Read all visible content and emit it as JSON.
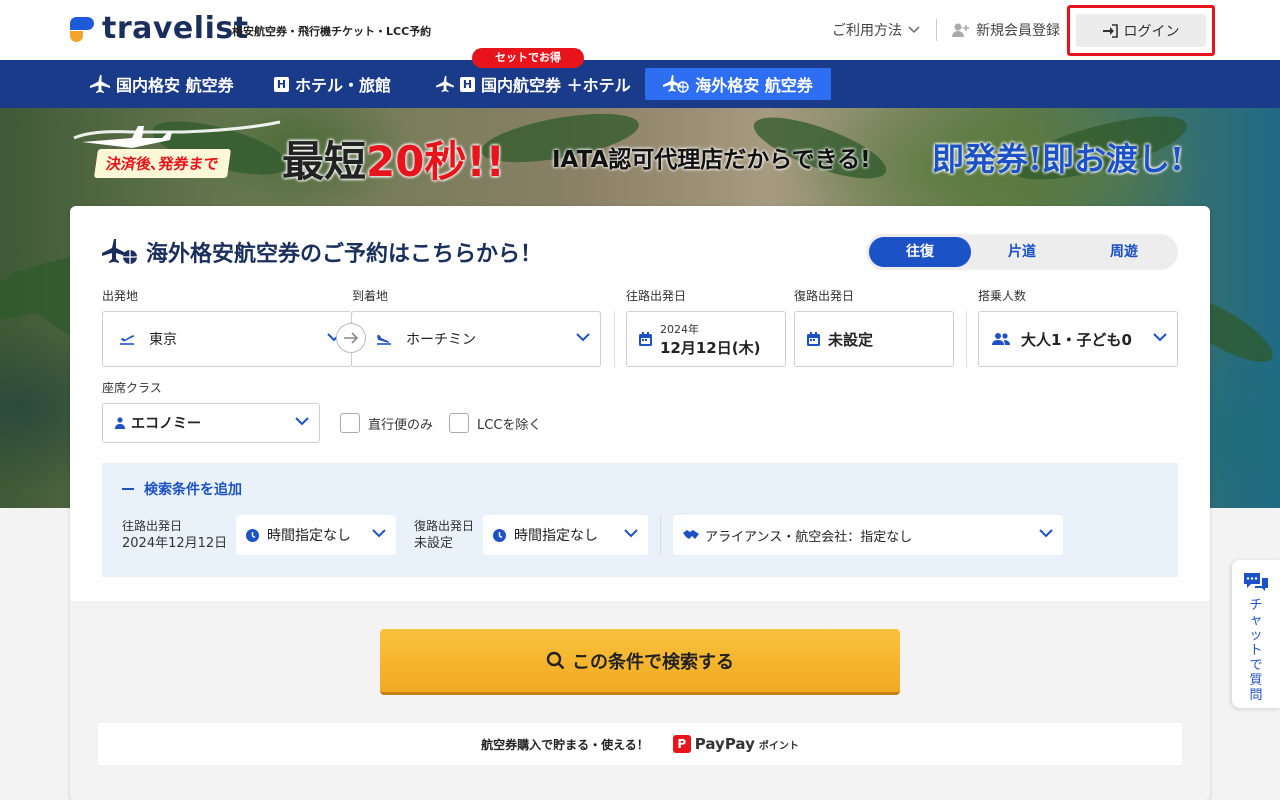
{
  "header": {
    "logo_text": "travelist",
    "tagline": "格安航空券・飛行機チケット・LCC予約",
    "help_label": "ご利用方法",
    "register_label": "新規会員登録",
    "login_label": "ログイン"
  },
  "nav": {
    "set_badge": "セットでお得",
    "items": [
      {
        "label": "国内格安 航空券",
        "icon": "airplane-icon"
      },
      {
        "label": "ホテル・旅館",
        "icon": "hotel-icon",
        "badge": "H"
      },
      {
        "label": "国内航空券 ＋ホテル",
        "icon": "airplane-hotel-icon",
        "badge": "H"
      },
      {
        "label": "海外格安 航空券",
        "icon": "airplane-globe-icon",
        "active": true
      }
    ]
  },
  "hero": {
    "tag": "決済後､発券まで",
    "big_prefix": "最短",
    "big_number": "20秒!!",
    "middle": "IATA認可代理店だからできる!",
    "blue": "即発券!即お渡し!"
  },
  "form": {
    "title": "海外格安航空券のご予約はこちらから！",
    "trip_types": [
      "往復",
      "片道",
      "周遊"
    ],
    "trip_active": "往復",
    "origin_label": "出発地",
    "origin_value": "東京",
    "destination_label": "到着地",
    "destination_value": "ホーチミン",
    "outbound_label": "往路出発日",
    "outbound_year": "2024年",
    "outbound_date": "12月12日(木)",
    "return_label": "復路出発日",
    "return_value": "未設定",
    "passengers_label": "搭乗人数",
    "passengers_value": "大人1・子ども0",
    "class_label": "座席クラス",
    "class_value": "エコノミー",
    "direct_only_label": "直行便のみ",
    "exclude_lcc_label": "LCCを除く"
  },
  "advanced": {
    "toggle_label": "検索条件を追加",
    "outbound_label": "往路出発日",
    "outbound_date": "2024年12月12日",
    "outbound_time": "時間指定なし",
    "return_label": "復路出発日",
    "return_date": "未設定",
    "return_time": "時間指定なし",
    "airline": "アライアンス・航空会社：指定なし"
  },
  "search_button_label": "この条件で検索する",
  "paypay": {
    "text": "航空券購入で貯まる・使える！",
    "logo_text": "PayPay",
    "logo_suffix": "ポイント"
  },
  "chat_label": "チャットで質問",
  "colors": {
    "navy": "#1a3a8a",
    "primary_blue": "#1d52c6",
    "accent_red": "#e8141c",
    "search_orange": "#f3a922"
  }
}
